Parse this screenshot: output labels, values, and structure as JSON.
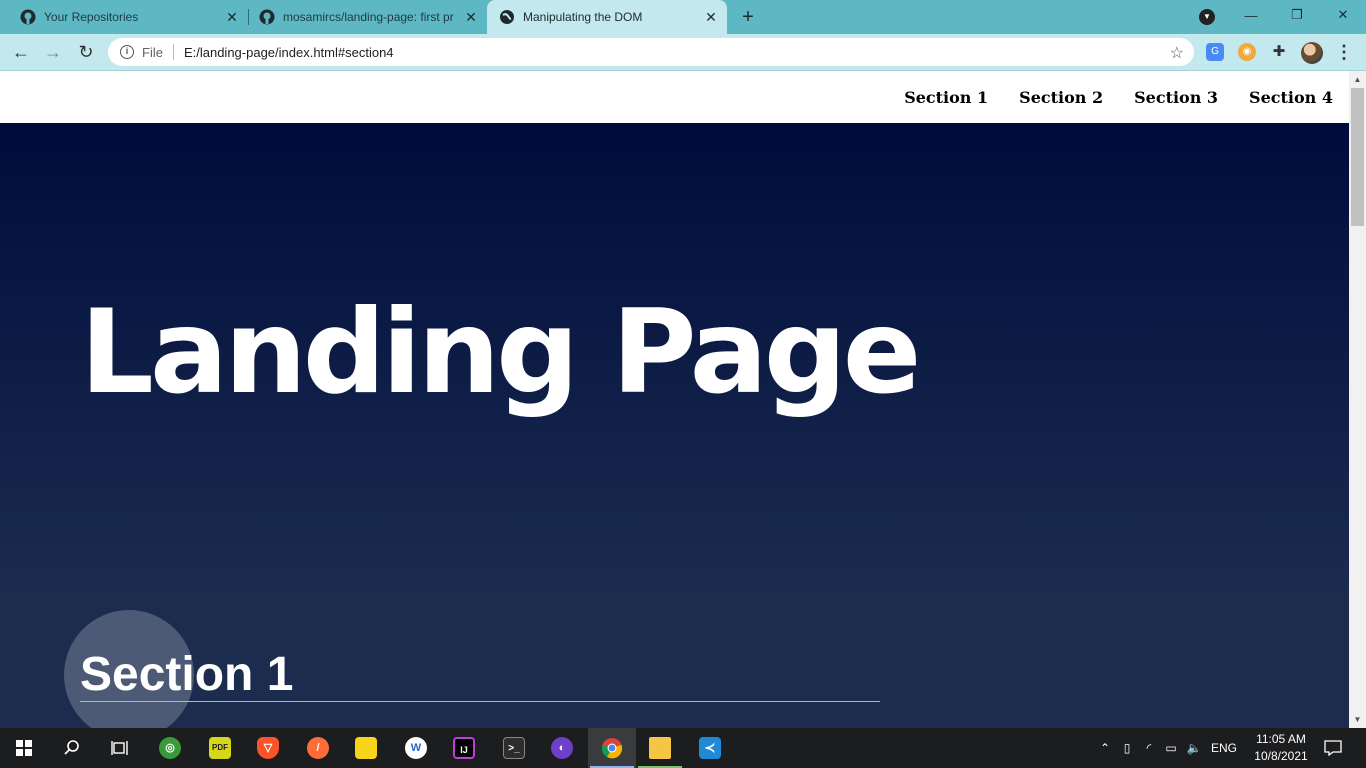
{
  "browser": {
    "tabs": [
      {
        "title": "Your Repositories",
        "icon": "github-icon",
        "active": false
      },
      {
        "title": "mosamircs/landing-page: first pr",
        "icon": "github-icon",
        "active": false
      },
      {
        "title": "Manipulating the DOM",
        "icon": "globe-icon",
        "active": true
      }
    ],
    "new_tab_label": "+",
    "window_controls": {
      "minimize": "—",
      "restore": "❐",
      "close": "✕"
    },
    "toolbar": {
      "back": "←",
      "forward": "→",
      "reload": "↻",
      "omnibox_scheme": "File",
      "url": "E:/landing-page/index.html#section4",
      "bookmark_star": "☆",
      "menu": "⋮"
    }
  },
  "page": {
    "nav": [
      "Section 1",
      "Section 2",
      "Section 3",
      "Section 4"
    ],
    "hero_title": "Landing Page",
    "section_heading": "Section 1",
    "colors": {
      "accent_rule": "#cccc11",
      "hero_gradient_top": "#000d3c",
      "hero_gradient_bottom": "#1b2c4f"
    }
  },
  "taskbar": {
    "tray": {
      "language": "ENG",
      "time": "11:05 AM",
      "date": "10/8/2021"
    }
  }
}
